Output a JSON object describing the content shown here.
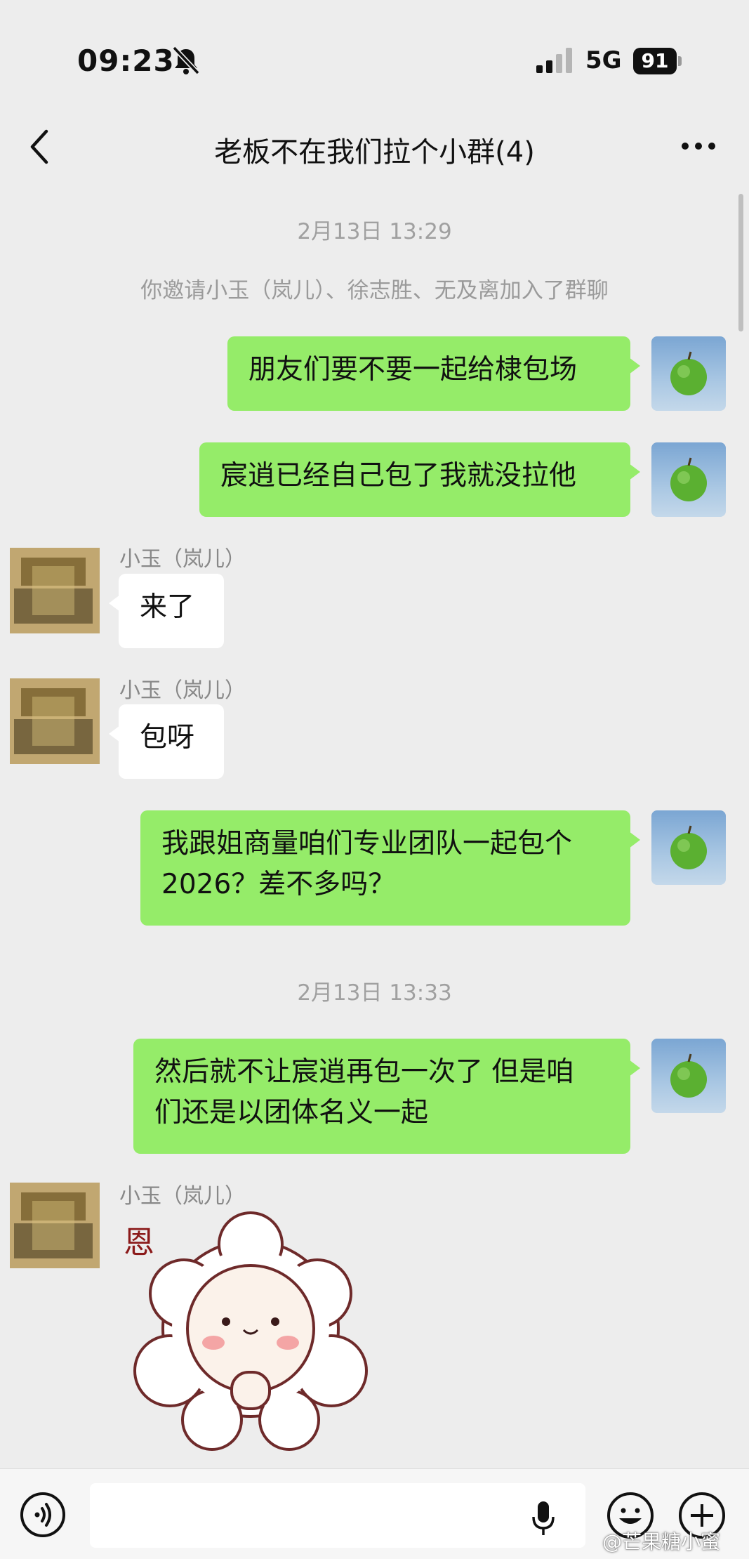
{
  "status_bar": {
    "time": "09:23",
    "network": "5G",
    "battery": "91"
  },
  "nav": {
    "title": "老板不在我们拉个小群(4)",
    "back_icon": "chevron-left-icon",
    "more_icon": "more-dots-icon"
  },
  "messages": {
    "time_1": "2月13日 13:29",
    "system_notice": "你邀请小玉（岚儿）、徐志胜、无及离加入了群聊",
    "msg_1": "朋友们要不要一起给棣包场",
    "msg_2": "宸逍已经自己包了我就没拉他",
    "sender_1": "小玉（岚儿）",
    "msg_3": "来了",
    "sender_2": "小玉（岚儿）",
    "msg_4": "包呀",
    "msg_5_line1": "我跟姐商量咱们专业团队一起包个",
    "msg_5_line2": "2026？差不多吗？",
    "time_2": "2月13日 13:33",
    "msg_6_line1": "然后就不让宸逍再包一次了 但是咱",
    "msg_6_line2": "们还是以团体名义一起",
    "sender_3": "小玉（岚儿）",
    "sticker_text": "恩"
  },
  "input_bar": {
    "voice_icon": "voice-icon",
    "mic_icon": "microphone-icon",
    "emoji_icon": "emoji-icon",
    "plus_icon": "plus-icon"
  },
  "watermark": "@芒果糖小蜜",
  "colors": {
    "background": "#ededed",
    "my_bubble": "#95ec69",
    "their_bubble": "#ffffff"
  }
}
